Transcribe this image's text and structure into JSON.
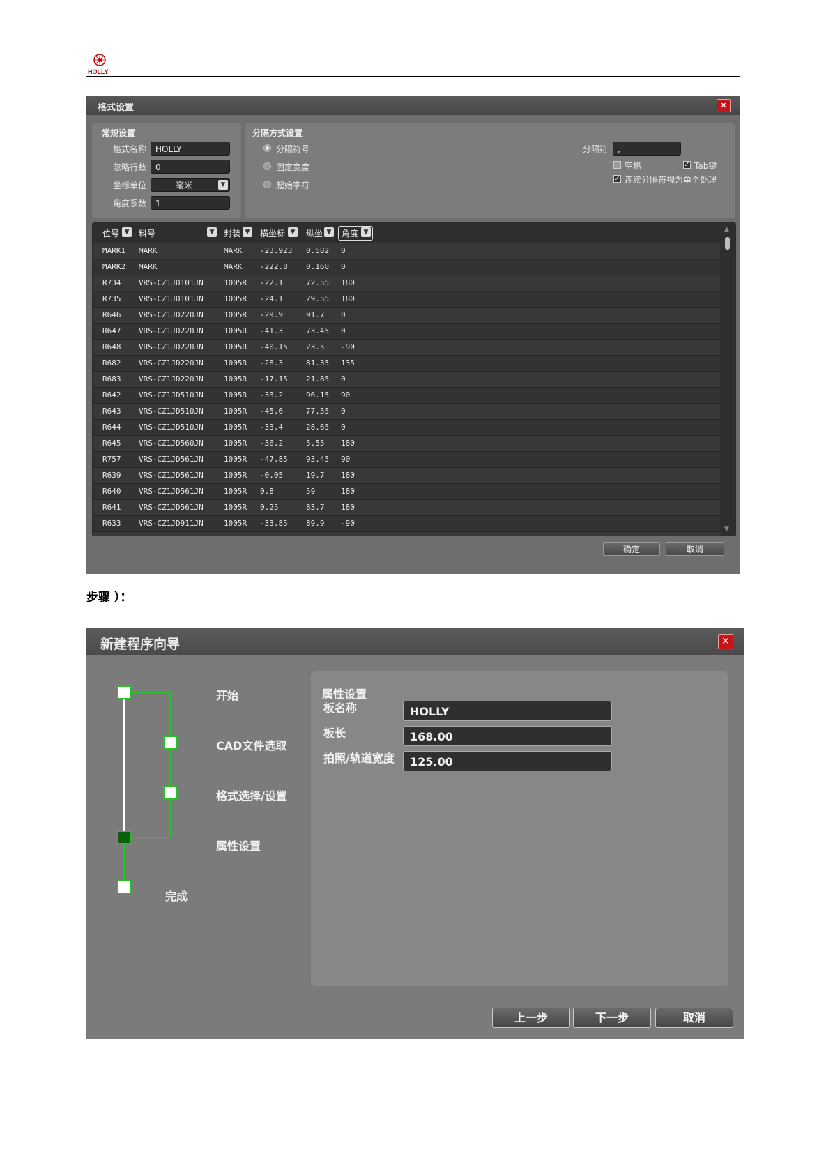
{
  "page": {
    "logo_text": "HOLLY",
    "step_text": "步骤 ）："
  },
  "format_dialog": {
    "title": "格式设置",
    "general": {
      "section_label": "常规设置",
      "name_label": "格式名称",
      "name_value": "HOLLY",
      "skip_label": "忽略行数",
      "skip_value": "0",
      "unit_label": "坐标单位",
      "unit_value": "毫米",
      "angle_label": "角度系数",
      "angle_value": "1"
    },
    "separator": {
      "section_label": "分隔方式设置",
      "options": [
        "分隔符号",
        "固定宽度",
        "起始字符"
      ],
      "selected_option": "分隔符号",
      "sep_label": "分隔符",
      "sep_value": ",",
      "space_label": "空格",
      "space_checked": false,
      "tab_label": "Tab键",
      "tab_checked": true,
      "consecutive_label": "连续分隔符视为单个处理",
      "consecutive_checked": true
    },
    "table": {
      "columns": [
        "位号",
        "料号",
        "封装",
        "横坐标",
        "纵坐",
        "角度"
      ],
      "rows": [
        [
          "MARK1",
          "MARK",
          "MARK",
          "-23.923",
          "0.582",
          "0"
        ],
        [
          "MARK2",
          "MARK",
          "MARK",
          "-222.8",
          "0.168",
          "0"
        ],
        [
          "R734",
          "VRS-CZ1JD101JN",
          "1005R",
          "-22.1",
          "72.55",
          "180"
        ],
        [
          "R735",
          "VRS-CZ1JD101JN",
          "1005R",
          "-24.1",
          "29.55",
          "180"
        ],
        [
          "R646",
          "VRS-CZ1JD220JN",
          "1005R",
          "-29.9",
          "91.7",
          "0"
        ],
        [
          "R647",
          "VRS-CZ1JD220JN",
          "1005R",
          "-41.3",
          "73.45",
          "0"
        ],
        [
          "R648",
          "VRS-CZ1JD220JN",
          "1005R",
          "-40.15",
          "23.5",
          "-90"
        ],
        [
          "R682",
          "VRS-CZ1JD220JN",
          "1005R",
          "-28.3",
          "81.35",
          "135"
        ],
        [
          "R683",
          "VRS-CZ1JD220JN",
          "1005R",
          "-17.15",
          "21.85",
          "0"
        ],
        [
          "R642",
          "VRS-CZ1JD510JN",
          "1005R",
          "-33.2",
          "96.15",
          "90"
        ],
        [
          "R643",
          "VRS-CZ1JD510JN",
          "1005R",
          "-45.6",
          "77.55",
          "0"
        ],
        [
          "R644",
          "VRS-CZ1JD510JN",
          "1005R",
          "-33.4",
          "28.65",
          "0"
        ],
        [
          "R645",
          "VRS-CZ1JD560JN",
          "1005R",
          "-36.2",
          "5.55",
          "180"
        ],
        [
          "R757",
          "VRS-CZ1JD561JN",
          "1005R",
          "-47.85",
          "93.45",
          "90"
        ],
        [
          "R639",
          "VRS-CZ1JD561JN",
          "1005R",
          "-0.05",
          "19.7",
          "180"
        ],
        [
          "R640",
          "VRS-CZ1JD561JN",
          "1005R",
          "0.8",
          "59",
          "180"
        ],
        [
          "R641",
          "VRS-CZ1JD561JN",
          "1005R",
          "0.25",
          "83.7",
          "180"
        ],
        [
          "R633",
          "VRS-CZ1JD911JN",
          "1005R",
          "-33.85",
          "89.9",
          "-90"
        ]
      ]
    },
    "ok_label": "确定",
    "cancel_label": "取消"
  },
  "wizard_dialog": {
    "title": "新建程序向导",
    "steps": [
      "开始",
      "CAD文件选取",
      "格式选择/设置",
      "属性设置",
      "完成"
    ],
    "active_step": "属性设置",
    "panel": {
      "section_label": "属性设置",
      "board_name_label": "板名称",
      "board_name_value": "HOLLY",
      "board_length_label": "板长",
      "board_length_value": "168.00",
      "track_width_label": "拍照/轨道宽度",
      "track_width_value": "125.00"
    },
    "prev_label": "上一步",
    "next_label": "下一步",
    "cancel_label": "取消"
  },
  "colors": {
    "accent_green": "#22c622",
    "close_red": "#c5141a"
  }
}
